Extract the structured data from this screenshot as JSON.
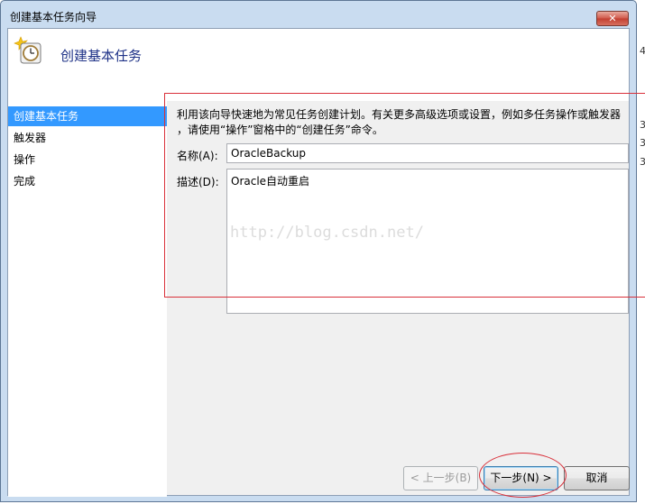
{
  "window": {
    "title": "创建基本任务向导",
    "close_glyph": "✕"
  },
  "header": {
    "title": "创建基本任务",
    "icon": "clock-task-icon"
  },
  "nav": {
    "items": [
      {
        "label": "创建基本任务",
        "active": true
      },
      {
        "label": "触发器",
        "active": false
      },
      {
        "label": "操作",
        "active": false
      },
      {
        "label": "完成",
        "active": false
      }
    ]
  },
  "form": {
    "description_line1": "利用该向导快速地为常见任务创建计划。有关更多高级选项或设置，例如多任务操作或触发器",
    "description_line2": "，请使用“操作”窗格中的“创建任务”命令。",
    "name_label": "名称(A):",
    "name_value": "OracleBackup",
    "desc_label": "描述(D):",
    "desc_value": "Oracle自动重启"
  },
  "watermark": "http://blog.csdn.net/",
  "buttons": {
    "back": "< 上一步(B)",
    "next": "下一步(N) >",
    "cancel": "取消"
  },
  "background_glyphs": [
    "4",
    "3",
    "3",
    "3"
  ],
  "colors": {
    "accent": "#3399ff",
    "annotation": "#d9303a",
    "title_text": "#1e3287"
  }
}
